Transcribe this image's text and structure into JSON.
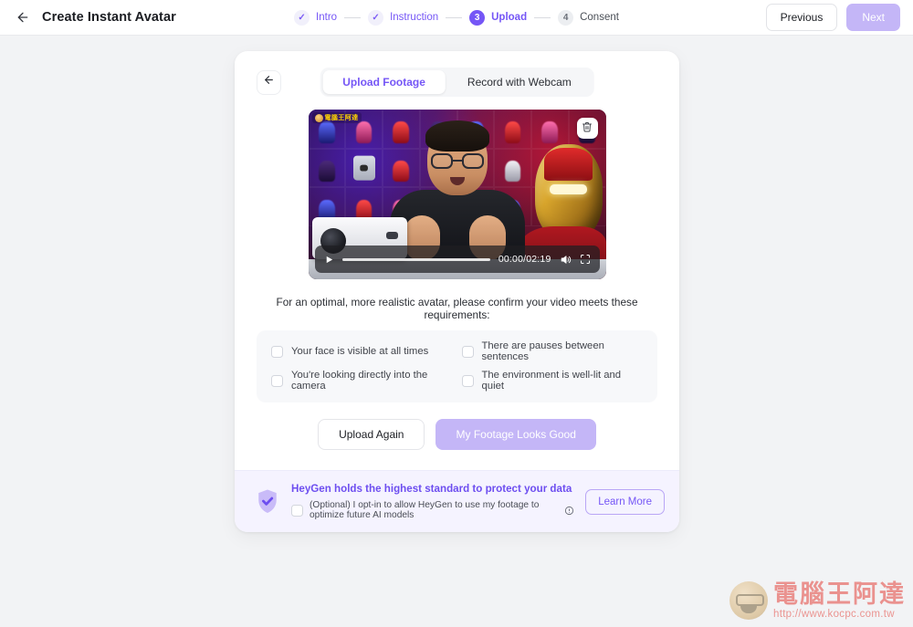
{
  "header": {
    "back_icon": "arrow-left-icon",
    "title": "Create Instant Avatar",
    "previous_label": "Previous",
    "next_label": "Next",
    "steps": [
      {
        "label": "Intro",
        "marker": "✓",
        "state": "done"
      },
      {
        "label": "Instruction",
        "marker": "✓",
        "state": "done"
      },
      {
        "label": "Upload",
        "marker": "3",
        "state": "active"
      },
      {
        "label": "Consent",
        "marker": "4",
        "state": "todo"
      }
    ]
  },
  "card": {
    "back_icon": "arrow-left-icon",
    "tabs": [
      {
        "label": "Upload Footage",
        "active": true
      },
      {
        "label": "Record with Webcam",
        "active": false
      }
    ],
    "video": {
      "delete_icon": "trash-icon",
      "play_icon": "play-icon",
      "volume_icon": "volume-icon",
      "fullscreen_icon": "fullscreen-icon",
      "time": "00:00/02:19",
      "progress_percent": 0,
      "watermark": "電腦王阿達"
    },
    "requirements": {
      "title": "For an optimal, more realistic avatar, please confirm your video meets these requirements:",
      "items": [
        {
          "label": "Your face is visible at all times",
          "checked": false
        },
        {
          "label": "There are pauses between sentences",
          "checked": false
        },
        {
          "label": "You're looking directly into the camera",
          "checked": false
        },
        {
          "label": "The environment is well-lit and quiet",
          "checked": false
        }
      ]
    },
    "actions": {
      "upload_again_label": "Upload Again",
      "looks_good_label": "My Footage Looks Good"
    },
    "privacy": {
      "shield_icon": "shield-check-icon",
      "title": "HeyGen holds the highest standard to protect your data",
      "optin_label": "(Optional) I opt-in to allow HeyGen to use my footage to optimize future AI models",
      "info_icon": "info-icon",
      "optin_checked": false,
      "learn_more_label": "Learn More"
    }
  },
  "watermark": {
    "brand": "電腦王阿達",
    "url": "http://www.kocpc.com.tw"
  },
  "colors": {
    "accent": "#7556f6",
    "accent_muted": "#c4b6f7",
    "page_bg": "#f2f3f5",
    "privacy_bg": "#f5f3ff",
    "watermark_red": "#e4342b"
  }
}
